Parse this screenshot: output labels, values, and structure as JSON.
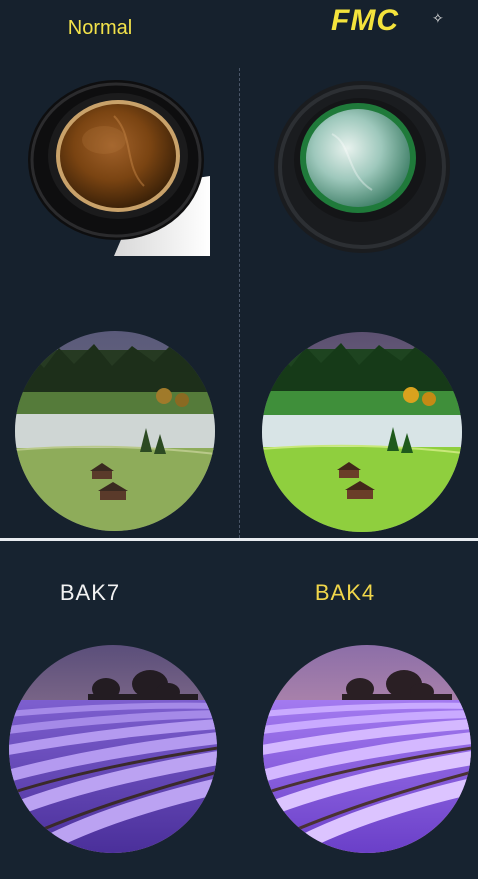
{
  "labels": {
    "top_left": "Normal",
    "top_right": "FMC",
    "bottom_left": "BAK7",
    "bottom_right": "BAK4"
  },
  "colors": {
    "normal_label": "#f2e24a",
    "fmc_label": "#f4e33c",
    "bak7_label": "#f2f2f2",
    "bak4_label": "#f0d64a",
    "background": "#16212d",
    "separator": "#e8ecf0"
  },
  "icons": {
    "sparkle": "sparkle-icon"
  }
}
